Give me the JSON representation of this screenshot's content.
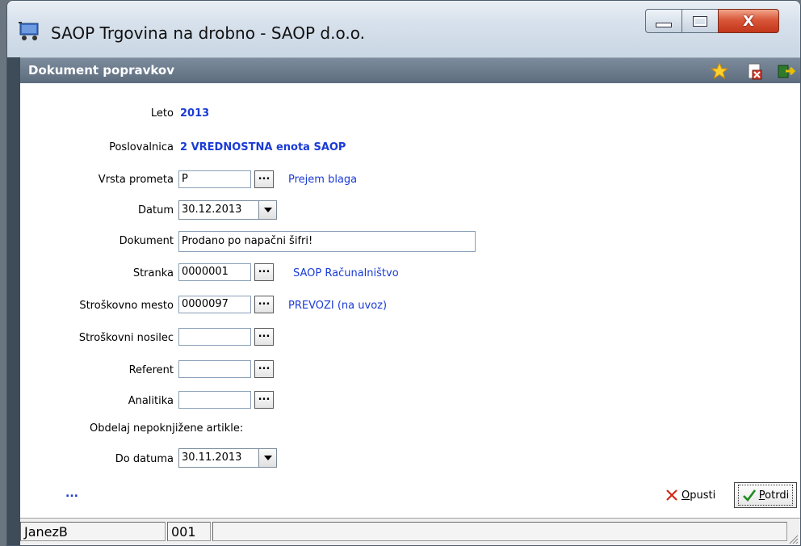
{
  "window": {
    "title": "SAOP Trgovina na drobno - SAOP d.o.o.",
    "minimize_label": "minimize",
    "maximize_label": "maximize",
    "close_label": "X"
  },
  "header": {
    "title": "Dokument popravkov",
    "icons": [
      "star-icon",
      "document-delete-icon",
      "exit-icon"
    ]
  },
  "form": {
    "leto": {
      "label": "Leto",
      "value": "2013"
    },
    "poslovalnica": {
      "label": "Poslovalnica",
      "value": "2 VREDNOSTNA enota SAOP"
    },
    "vrsta_prometa": {
      "label": "Vrsta prometa",
      "value": "P",
      "button": "...",
      "description": "Prejem blaga"
    },
    "datum": {
      "label": "Datum",
      "value": "30.12.2013"
    },
    "dokument": {
      "label": "Dokument",
      "value": "Prodano po napačni šifri!"
    },
    "stranka": {
      "label": "Stranka",
      "value": "0000001",
      "button": "...",
      "description": "SAOP Računalništvo"
    },
    "stroskovno_mesto": {
      "label": "Stroškovno mesto",
      "value": "0000097",
      "button": "...",
      "description": "PREVOZI (na uvoz)"
    },
    "stroskovni_nosilec": {
      "label": "Stroškovni nosilec",
      "value": "",
      "button": "..."
    },
    "referent": {
      "label": "Referent",
      "value": "",
      "button": "..."
    },
    "analitika": {
      "label": "Analitika",
      "value": "",
      "button": "..."
    },
    "section_label": "Obdelaj nepoknjižene artikle:",
    "do_datuma": {
      "label": "Do datuma",
      "value": "30.11.2013"
    }
  },
  "footer": {
    "more": "...",
    "cancel_label": "Opusti",
    "ok_label": "Potrdi"
  },
  "statusbar": {
    "user": "JanezB",
    "code": "001"
  },
  "colors": {
    "accent_blue": "#1a3bd6",
    "header_bg": "#6d7c8d",
    "close_red": "#c3361b"
  }
}
